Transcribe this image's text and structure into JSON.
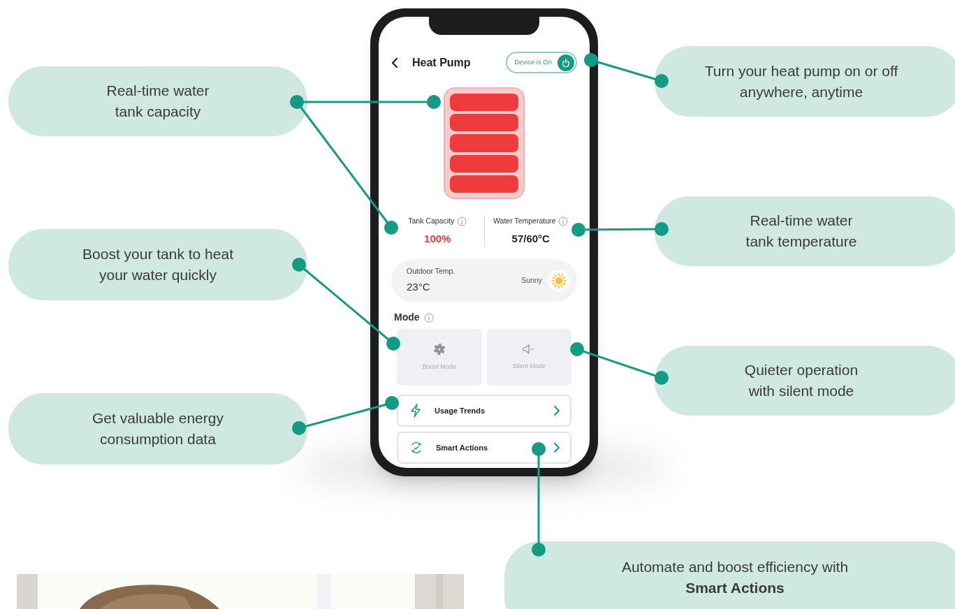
{
  "phone": {
    "header": {
      "title": "Heat Pump",
      "power": {
        "label": "Device is On",
        "on": true
      }
    },
    "tank": {
      "level": 1
    },
    "stats": [
      {
        "label": "Tank Capacity",
        "value": "100%",
        "kind": "alert"
      },
      {
        "label": "Water Temperature",
        "value": "57/60°C",
        "kind": "normal"
      }
    ],
    "weather": {
      "label": "Outdoor Temp.",
      "value": "23°C",
      "condition": "Sunny"
    },
    "mode": {
      "title": "Mode",
      "options": [
        {
          "label": "Boost Mode",
          "kind": "boost",
          "selected": false
        },
        {
          "label": "Silent Mode",
          "kind": "silent",
          "selected": false
        }
      ]
    },
    "links": [
      {
        "label": "Usage Trends",
        "kind": "trends"
      },
      {
        "label": "Smart Actions",
        "kind": "actions"
      }
    ]
  },
  "callouts": [
    {
      "text": "Real-time water\ntank capacity"
    },
    {
      "text": "Boost your tank to heat\nyour water quickly"
    },
    {
      "text": "Get valuable energy\nconsumption data"
    },
    {
      "text": "Turn your heat pump on or off\nanywhere, anytime"
    },
    {
      "text": "Real-time water\ntank temperature"
    },
    {
      "text": "Quieter operation\nwith silent mode"
    },
    {
      "text": "Automate and boost efficiency with\n**Smart Actions**"
    }
  ]
}
